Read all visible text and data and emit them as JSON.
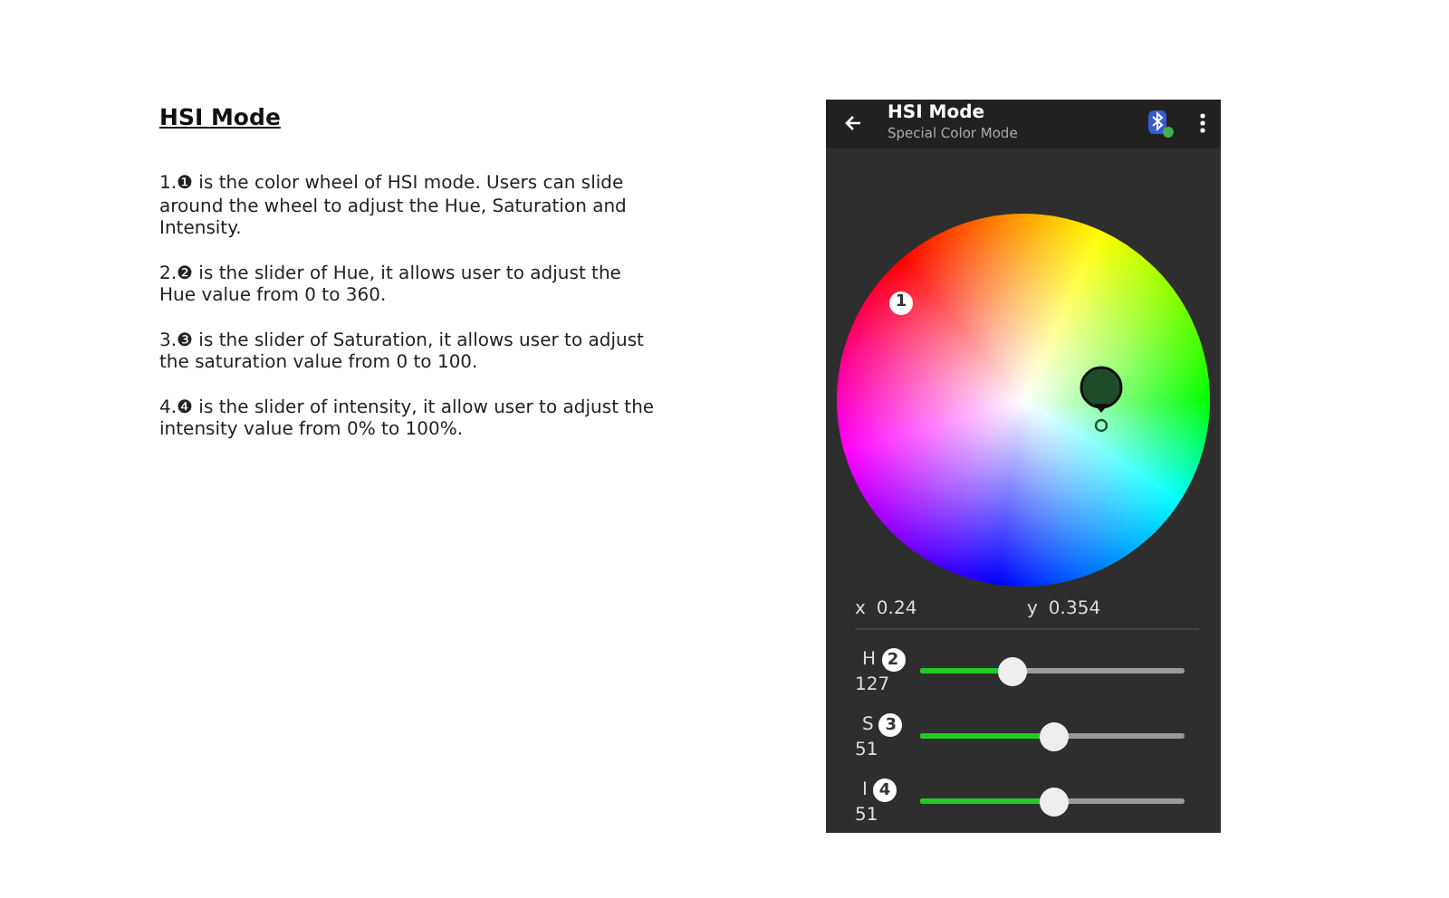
{
  "doc": {
    "title": "HSI Mode",
    "paragraphs": [
      "1.❶ is the color wheel of HSI mode. Users can slide around the wheel to adjust the Hue, Saturation and Intensity.",
      "2.❷ is the slider of Hue, it allows user to adjust the Hue value from 0 to 360.",
      "3.❸ is the slider of Saturation, it allows user to adjust the saturation value from 0 to 100.",
      "4.❹ is the slider of intensity, it allow user to adjust the intensity value from 0% to 100%."
    ]
  },
  "phone": {
    "title": "HSI Mode",
    "subtitle": "Special Color Mode",
    "wheel_badge": "1",
    "x_label": "x",
    "x_value": "0.24",
    "y_label": "y",
    "y_value": "0.354",
    "sliders": [
      {
        "label": "H",
        "badge": "2",
        "value": "127",
        "level": 0.35
      },
      {
        "label": "S",
        "badge": "3",
        "value": "51",
        "level": 0.51
      },
      {
        "label": "I",
        "badge": "4",
        "value": "51",
        "level": 0.51
      }
    ]
  }
}
